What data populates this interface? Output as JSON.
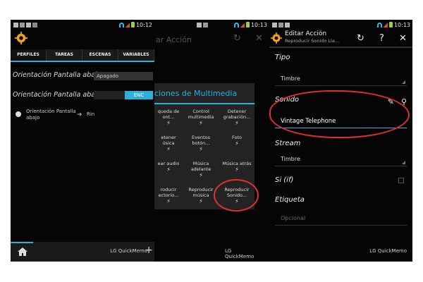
{
  "status": {
    "time1": "10:12",
    "time2": "10:13",
    "time3": "10:13"
  },
  "panel1": {
    "title_behind": "ar Acción",
    "tabs": [
      {
        "label": "PERFILES"
      },
      {
        "label": "TAREAS"
      },
      {
        "label": "ESCENAS"
      },
      {
        "label": "VARIABLES"
      }
    ],
    "rows": [
      {
        "label": "Orientación Pantalla abajo",
        "value": "Apagado"
      },
      {
        "label": "Orientación Pantalla abajo",
        "value": "ENC"
      }
    ],
    "task": {
      "label": "Orientación Pantalla abajo",
      "action": "Rin"
    },
    "footer": "LG QuickMemo"
  },
  "grid": {
    "title": "ciones de Multimedia",
    "cells": [
      {
        "line1": "queda de",
        "line2": "ont..."
      },
      {
        "line1": "Control",
        "line2": "multimedia"
      },
      {
        "line1": "Detener",
        "line2": "grabación..."
      },
      {
        "line1": "etener",
        "line2": "úsica"
      },
      {
        "line1": "Eventos",
        "line2": "botón..."
      },
      {
        "line1": "Foto",
        "line2": ""
      },
      {
        "line1": "ear audio",
        "line2": ""
      },
      {
        "line1": "Música",
        "line2": "adelante"
      },
      {
        "line1": "Música atrás",
        "line2": ""
      },
      {
        "line1": "roducir",
        "line2": "ectorio..."
      },
      {
        "line1": "Reproducir",
        "line2": "música"
      },
      {
        "line1": "Reproducir",
        "line2": "Sonido..."
      }
    ],
    "footer": "LG QuickMemo"
  },
  "panel3": {
    "title": "Editar Acción",
    "subtitle": "Reproducir Sonido Lla...",
    "fields": {
      "tipo_label": "Tipo",
      "tipo_value": "Timbre",
      "sonido_label": "Sonido",
      "sonido_value": "Vintage Telephone",
      "stream_label": "Stream",
      "stream_value": "Timbre",
      "si_label": "Si (if)",
      "etiqueta_label": "Etiqueta",
      "etiqueta_placeholder": "Opcional"
    },
    "footer": "LG QuickMemo"
  },
  "colors": {
    "accent": "#2bb0e0",
    "annotation": "#e03030",
    "green": "#7ec83a"
  }
}
